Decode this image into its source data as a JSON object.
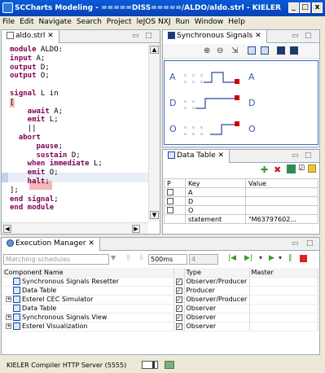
{
  "window": {
    "title": "SCCharts Modeling - =====DISS=====/ALDO/aldo.strl - KIELER",
    "minimize": "_",
    "maximize": "□",
    "close": "x"
  },
  "menu": [
    "File",
    "Edit",
    "Navigate",
    "Search",
    "Project",
    "leJOS NXJ",
    "Run",
    "Window",
    "Help"
  ],
  "editor": {
    "tab_label": "aldo.strl",
    "tab_close": "✕",
    "lines": [
      {
        "kw": "module",
        "rest": " ALDO:"
      },
      {
        "kw": "input",
        "rest": " A;"
      },
      {
        "kw": "output",
        "rest": " D;"
      },
      {
        "kw": "output",
        "rest": " O;"
      },
      {
        "kw": "",
        "rest": ""
      },
      {
        "kw": "signal",
        "rest": " L in"
      },
      {
        "kw": "",
        "rest": "["
      },
      {
        "kw": "    await",
        "rest": " A;"
      },
      {
        "kw": "    emit",
        "rest": " L;"
      },
      {
        "kw": "",
        "rest": "    ||"
      },
      {
        "kw": "  abort",
        "rest": ""
      },
      {
        "kw": "      pause",
        "rest": ";"
      },
      {
        "kw": "      sustain",
        "rest": " D;"
      },
      {
        "kw": "    when immediate",
        "rest": " L;"
      },
      {
        "kw": "    emit",
        "rest": " O;"
      },
      {
        "kw": "    halt",
        "rest": ";"
      },
      {
        "kw": "",
        "rest": "];"
      },
      {
        "kw": "end signal",
        "rest": ";"
      },
      {
        "kw": "end module",
        "rest": ""
      }
    ]
  },
  "signals_view": {
    "tab_label": "Synchronous Signals",
    "tab_close": "✕",
    "labels": [
      "A",
      "D",
      "O"
    ],
    "labels_right": [
      "A",
      "D",
      "O"
    ]
  },
  "data_table": {
    "tab_label": "Data Table",
    "tab_close": "✕",
    "columns": [
      "P",
      "Key",
      "Value"
    ],
    "rows": [
      {
        "key": "A",
        "value": ""
      },
      {
        "key": "D",
        "value": ""
      },
      {
        "key": "O",
        "value": ""
      },
      {
        "key": "statement",
        "value": "\"M63797602..."
      }
    ]
  },
  "exec_manager": {
    "tab_label": "Execution Manager",
    "tab_close": "✕",
    "schedule_placeholder": "Matching schedules",
    "step_time": "500ms",
    "step_count": "4",
    "columns": [
      "Component Name",
      "Type",
      "Master"
    ],
    "rows": [
      {
        "name": "Synchronous Signals Resetter",
        "type": "Observer/Producer",
        "expandable": false,
        "icon": "resetter-icon"
      },
      {
        "name": "Data Table",
        "type": "Producer",
        "expandable": false,
        "icon": "table-icon"
      },
      {
        "name": "Esterel CEC Simulator",
        "type": "Observer/Producer",
        "expandable": true,
        "icon": "simulator-icon"
      },
      {
        "name": "Data Table",
        "type": "Observer",
        "expandable": false,
        "icon": "table-icon"
      },
      {
        "name": "Synchronous Signals View",
        "type": "Observer",
        "expandable": true,
        "icon": "signals-icon"
      },
      {
        "name": "Esterel Visualization",
        "type": "Observer",
        "expandable": true,
        "icon": "visualization-icon"
      }
    ]
  },
  "status_bar": {
    "text": "KIELER Compiler HTTP Server (5555)"
  },
  "colors": {
    "title_blue": "#0842b5",
    "keyword": "#7f0055",
    "signal_blue": "#3a5aa8",
    "highlight_red": "#f4b8b8",
    "signal_red": "#cc0000"
  }
}
